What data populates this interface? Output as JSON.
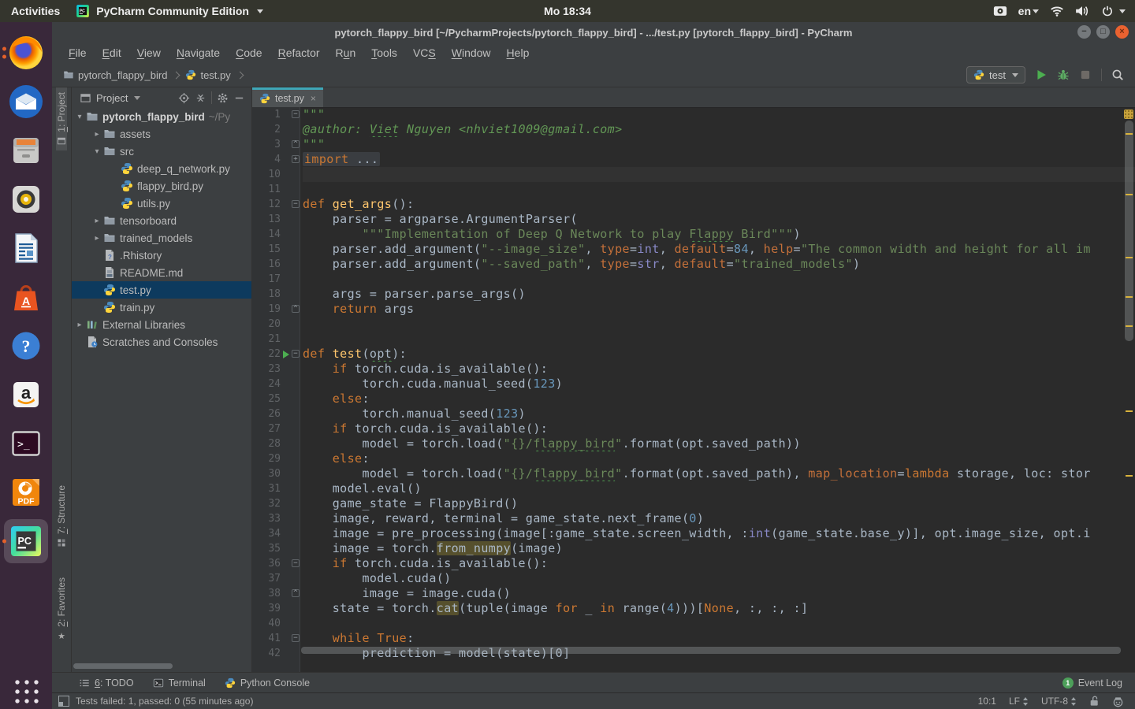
{
  "colors": {
    "tab_accent": "#3fa7b8",
    "tree_selection": "#0d3a5e",
    "ubuntu_orange": "#e95420",
    "run_green": "#4cae50",
    "warning_stripe": "#d9b33c",
    "editor_bg": "#2b2b2b",
    "panel_bg": "#3c3f41"
  },
  "ubuntu": {
    "activities": "Activities",
    "app_name": "PyCharm Community Edition",
    "clock": "Mo 18:34",
    "lang": "en"
  },
  "dock": {
    "items": [
      {
        "name": "firefox",
        "dots": 2
      },
      {
        "name": "thunderbird",
        "dots": 0
      },
      {
        "name": "files",
        "dots": 0
      },
      {
        "name": "rhythmbox",
        "dots": 0
      },
      {
        "name": "writer",
        "dots": 0
      },
      {
        "name": "software",
        "dots": 0
      },
      {
        "name": "help",
        "dots": 0
      },
      {
        "name": "amazon",
        "dots": 0
      },
      {
        "name": "terminal",
        "dots": 0
      },
      {
        "name": "foxit",
        "dots": 0
      },
      {
        "name": "pycharm",
        "dots": 1,
        "active": true
      }
    ]
  },
  "window": {
    "title": "pytorch_flappy_bird [~/PycharmProjects/pytorch_flappy_bird] - .../test.py [pytorch_flappy_bird] - PyCharm"
  },
  "menu": {
    "items": [
      {
        "label": "File",
        "u": 0
      },
      {
        "label": "Edit",
        "u": 0
      },
      {
        "label": "View",
        "u": 0
      },
      {
        "label": "Navigate",
        "u": 0
      },
      {
        "label": "Code",
        "u": 0
      },
      {
        "label": "Refactor",
        "u": 0
      },
      {
        "label": "Run",
        "u": 1
      },
      {
        "label": "Tools",
        "u": 0
      },
      {
        "label": "VCS",
        "u": 2
      },
      {
        "label": "Window",
        "u": 0
      },
      {
        "label": "Help",
        "u": 0
      }
    ]
  },
  "navbar": {
    "run_config": "test",
    "breadcrumbs": [
      {
        "label": "pytorch_flappy_bird",
        "icon": "folder"
      },
      {
        "label": "test.py",
        "icon": "python"
      }
    ]
  },
  "stripe": {
    "top": [
      {
        "label": "1: Project",
        "icon": "project",
        "pressed": true
      }
    ],
    "bottom": [
      {
        "label": "7: Structure",
        "icon": "structure"
      },
      {
        "label": "2: Favorites",
        "icon": "star"
      }
    ]
  },
  "project": {
    "header": "Project",
    "tree": [
      {
        "label": "pytorch_flappy_bird",
        "suffix": " ~/Py",
        "icon": "folder",
        "indent": 0,
        "arrow": "down",
        "bold": true
      },
      {
        "label": "assets",
        "icon": "folder",
        "indent": 1,
        "arrow": "right"
      },
      {
        "label": "src",
        "icon": "folder",
        "indent": 1,
        "arrow": "down"
      },
      {
        "label": "deep_q_network.py",
        "icon": "python",
        "indent": 2
      },
      {
        "label": "flappy_bird.py",
        "icon": "python",
        "indent": 2
      },
      {
        "label": "utils.py",
        "icon": "python",
        "indent": 2
      },
      {
        "label": "tensorboard",
        "icon": "folder",
        "indent": 1,
        "arrow": "right"
      },
      {
        "label": "trained_models",
        "icon": "folder",
        "indent": 1,
        "arrow": "right"
      },
      {
        "label": ".Rhistory",
        "icon": "unknown",
        "indent": 1
      },
      {
        "label": "README.md",
        "icon": "md",
        "indent": 1
      },
      {
        "label": "test.py",
        "icon": "python",
        "indent": 1,
        "selected": true
      },
      {
        "label": "train.py",
        "icon": "python",
        "indent": 1
      },
      {
        "label": "External Libraries",
        "icon": "lib",
        "indent": 0,
        "arrow": "right"
      },
      {
        "label": "Scratches and Consoles",
        "icon": "scratch",
        "indent": 0
      }
    ]
  },
  "editor": {
    "tab": "test.py",
    "warn_ticks": [
      58,
      135,
      215,
      265,
      302,
      410,
      492
    ],
    "lines": [
      {
        "n": 1,
        "fold": "start",
        "t": [
          [
            "d",
            "\"\"\""
          ]
        ]
      },
      {
        "n": 2,
        "t": [
          [
            "di",
            "@author: "
          ],
          [
            "di typo",
            "Viet"
          ],
          [
            "di",
            " Nguyen <nhviet1009@gmail.com>"
          ]
        ]
      },
      {
        "n": 3,
        "fold": "end",
        "t": [
          [
            "d",
            "\"\"\""
          ]
        ]
      },
      {
        "n": 4,
        "fold": "plus",
        "folded": true,
        "t": [
          [
            "k",
            "import"
          ],
          [
            "p",
            " ..."
          ]
        ]
      },
      {
        "n": 10,
        "caret": true,
        "t": []
      },
      {
        "n": 11,
        "t": []
      },
      {
        "n": 12,
        "fold": "start",
        "t": [
          [
            "k",
            "def "
          ],
          [
            "f",
            "get_args"
          ],
          [
            "p",
            "():"
          ]
        ]
      },
      {
        "n": 13,
        "t": [
          [
            "p",
            "    parser = argparse.ArgumentParser("
          ]
        ]
      },
      {
        "n": 14,
        "t": [
          [
            "s",
            "        \"\"\"Implementation of Deep Q Network to play "
          ],
          [
            "s typo",
            "Flappy"
          ],
          [
            "s",
            " Bird\"\"\""
          ],
          [
            "p",
            ")"
          ]
        ]
      },
      {
        "n": 15,
        "t": [
          [
            "p",
            "    parser.add_argument("
          ],
          [
            "s",
            "\"--image_size\""
          ],
          [
            "p",
            ", "
          ],
          [
            "a",
            "type"
          ],
          [
            "p",
            "="
          ],
          [
            "b",
            "int"
          ],
          [
            "p",
            ", "
          ],
          [
            "a",
            "default"
          ],
          [
            "p",
            "="
          ],
          [
            "num",
            "84"
          ],
          [
            "p",
            ", "
          ],
          [
            "a",
            "help"
          ],
          [
            "p",
            "="
          ],
          [
            "s",
            "\"The common width and height for all im"
          ]
        ]
      },
      {
        "n": 16,
        "t": [
          [
            "p",
            "    parser.add_argument("
          ],
          [
            "s",
            "\"--saved_path\""
          ],
          [
            "p",
            ", "
          ],
          [
            "a",
            "type"
          ],
          [
            "p",
            "="
          ],
          [
            "b",
            "str"
          ],
          [
            "p",
            ", "
          ],
          [
            "a",
            "default"
          ],
          [
            "p",
            "="
          ],
          [
            "s",
            "\"trained_models\""
          ],
          [
            "p",
            ")"
          ]
        ]
      },
      {
        "n": 17,
        "t": []
      },
      {
        "n": 18,
        "t": [
          [
            "p",
            "    args = parser.parse_args()"
          ]
        ]
      },
      {
        "n": 19,
        "fold": "end",
        "t": [
          [
            "p",
            "    "
          ],
          [
            "k",
            "return"
          ],
          [
            "p",
            " args"
          ]
        ]
      },
      {
        "n": 20,
        "t": []
      },
      {
        "n": 21,
        "t": []
      },
      {
        "n": 22,
        "fold": "start",
        "run": true,
        "t": [
          [
            "k",
            "def "
          ],
          [
            "f",
            "test"
          ],
          [
            "p",
            "("
          ],
          [
            "p typo",
            "opt"
          ],
          [
            "p",
            "):"
          ]
        ]
      },
      {
        "n": 23,
        "t": [
          [
            "p",
            "    "
          ],
          [
            "k",
            "if"
          ],
          [
            "p",
            " torch.cuda.is_available():"
          ]
        ]
      },
      {
        "n": 24,
        "t": [
          [
            "p",
            "        torch.cuda.manual_seed("
          ],
          [
            "num",
            "123"
          ],
          [
            "p",
            ")"
          ]
        ]
      },
      {
        "n": 25,
        "t": [
          [
            "p",
            "    "
          ],
          [
            "k",
            "else"
          ],
          [
            "p",
            ":"
          ]
        ]
      },
      {
        "n": 26,
        "t": [
          [
            "p",
            "        torch.manual_seed("
          ],
          [
            "num",
            "123"
          ],
          [
            "p",
            ")"
          ]
        ]
      },
      {
        "n": 27,
        "t": [
          [
            "p",
            "    "
          ],
          [
            "k",
            "if"
          ],
          [
            "p",
            " torch.cuda.is_available():"
          ]
        ]
      },
      {
        "n": 28,
        "t": [
          [
            "p",
            "        model = torch.load("
          ],
          [
            "s",
            "\"{}/"
          ],
          [
            "s typo",
            "flappy_bird"
          ],
          [
            "s",
            "\""
          ],
          [
            "p",
            ".format(opt.saved_path))"
          ]
        ]
      },
      {
        "n": 29,
        "t": [
          [
            "p",
            "    "
          ],
          [
            "k",
            "else"
          ],
          [
            "p",
            ":"
          ]
        ]
      },
      {
        "n": 30,
        "t": [
          [
            "p",
            "        model = torch.load("
          ],
          [
            "s",
            "\"{}/"
          ],
          [
            "s typo",
            "flappy_bird"
          ],
          [
            "s",
            "\""
          ],
          [
            "p",
            ".format(opt.saved_path), "
          ],
          [
            "a",
            "map_location"
          ],
          [
            "p",
            "="
          ],
          [
            "k",
            "lambda"
          ],
          [
            "p",
            " storage, loc: stor"
          ]
        ]
      },
      {
        "n": 31,
        "t": [
          [
            "p",
            "    model.eval()"
          ]
        ]
      },
      {
        "n": 32,
        "t": [
          [
            "p",
            "    game_state = FlappyBird()"
          ]
        ]
      },
      {
        "n": 33,
        "t": [
          [
            "p",
            "    image, reward, terminal = game_state.next_frame("
          ],
          [
            "num",
            "0"
          ],
          [
            "p",
            ")"
          ]
        ]
      },
      {
        "n": 34,
        "t": [
          [
            "p",
            "    image = pre_processing(image[:game_state.screen_width, :"
          ],
          [
            "b",
            "int"
          ],
          [
            "p",
            "(game_state.base_y)], opt.image_size, opt.i"
          ]
        ]
      },
      {
        "n": 35,
        "t": [
          [
            "p",
            "    image = torch."
          ],
          [
            "p hl",
            "from_numpy"
          ],
          [
            "p",
            "(image)"
          ]
        ]
      },
      {
        "n": 36,
        "fold": "start",
        "t": [
          [
            "p",
            "    "
          ],
          [
            "k",
            "if"
          ],
          [
            "p",
            " torch.cuda.is_available():"
          ]
        ]
      },
      {
        "n": 37,
        "t": [
          [
            "p",
            "        model.cuda()"
          ]
        ]
      },
      {
        "n": 38,
        "fold": "end",
        "t": [
          [
            "p",
            "        image = image.cuda()"
          ]
        ]
      },
      {
        "n": 39,
        "t": [
          [
            "p",
            "    state = torch."
          ],
          [
            "p hl",
            "cat"
          ],
          [
            "p",
            "(tuple(image "
          ],
          [
            "k",
            "for"
          ],
          [
            "p",
            " _ "
          ],
          [
            "k",
            "in"
          ],
          [
            "p",
            " range("
          ],
          [
            "num",
            "4"
          ],
          [
            "p",
            ")))["
          ],
          [
            "k",
            "None"
          ],
          [
            "p",
            ", :, :, :]"
          ]
        ]
      },
      {
        "n": 40,
        "t": []
      },
      {
        "n": 41,
        "fold": "start",
        "t": [
          [
            "p",
            "    "
          ],
          [
            "k",
            "while"
          ],
          [
            "p",
            " "
          ],
          [
            "k",
            "True"
          ],
          [
            "p",
            ":"
          ]
        ]
      },
      {
        "n": 42,
        "t": [
          [
            "p",
            "        prediction = model(state)[0]"
          ]
        ]
      }
    ]
  },
  "bottom": {
    "todo": "6: TODO",
    "terminal": "Terminal",
    "python_console": "Python Console",
    "event_log": "Event Log",
    "event_count": "1"
  },
  "status": {
    "message": "Tests failed: 1, passed: 0 (55 minutes ago)",
    "caret": "10:1",
    "line_ending": "LF",
    "encoding": "UTF-8"
  }
}
